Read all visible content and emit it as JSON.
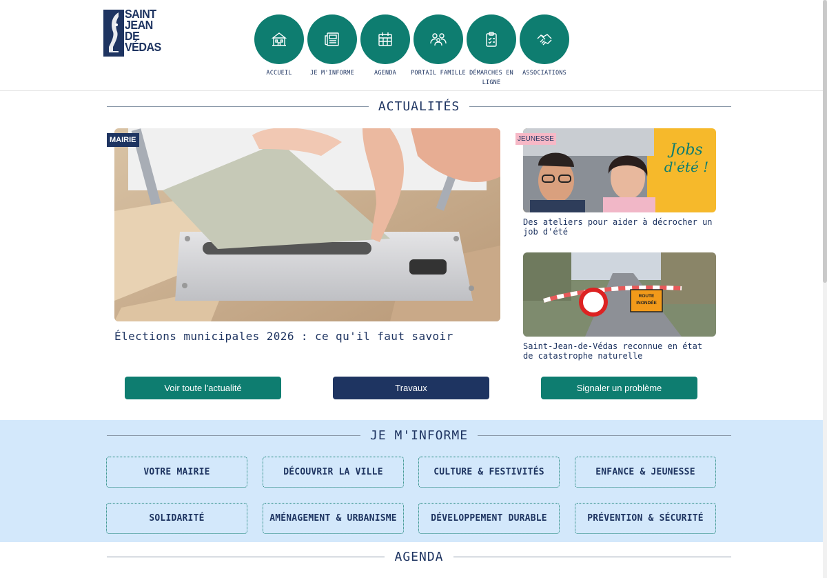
{
  "logo": {
    "lines": [
      "SAINT",
      "JEAN",
      "DE",
      "VÉDAS"
    ]
  },
  "nav": [
    {
      "label": "ACCUEIL",
      "icon": "town-hall-icon"
    },
    {
      "label": "JE M'INFORME",
      "icon": "newspaper-icon"
    },
    {
      "label": "AGENDA",
      "icon": "calendar-icon"
    },
    {
      "label": "PORTAIL FAMILLE",
      "icon": "family-icon"
    },
    {
      "label": "DÉMARCHES EN LIGNE",
      "icon": "clipboard-icon"
    },
    {
      "label": "ASSOCIATIONS",
      "icon": "handshake-icon"
    }
  ],
  "news": {
    "title": "ACTUALITÉS",
    "main": {
      "tag": "MAIRIE",
      "title": "Élections municipales 2026 : ce qu'il faut savoir"
    },
    "side": [
      {
        "tag": "JEUNESSE",
        "title": "Des ateliers pour aider à décrocher un job d'été",
        "image_text": [
          "Jobs",
          "d'été !"
        ]
      },
      {
        "title": "Saint-Jean-de-Védas reconnue en état de catastrophe naturelle",
        "image_text": [
          "ROUTE",
          "INONDÉE"
        ]
      }
    ],
    "buttons": [
      "Voir toute l'actualité",
      "Travaux",
      "Signaler un problème"
    ]
  },
  "info": {
    "title": "JE M'INFORME",
    "items": [
      "VOTRE MAIRIE",
      "DÉCOUVRIR LA VILLE",
      "CULTURE & FESTIVITÉS",
      "ENFANCE & JEUNESSE",
      "SOLIDARITÉ",
      "AMÉNAGEMENT & URBANISME",
      "DÉVELOPPEMENT DURABLE",
      "PRÉVENTION & SÉCURITÉ"
    ]
  },
  "agenda": {
    "title": "AGENDA"
  },
  "colors": {
    "green": "#0e7d70",
    "navy": "#1e3461",
    "band": "#d3e8fb",
    "yellow": "#f6b92b"
  }
}
